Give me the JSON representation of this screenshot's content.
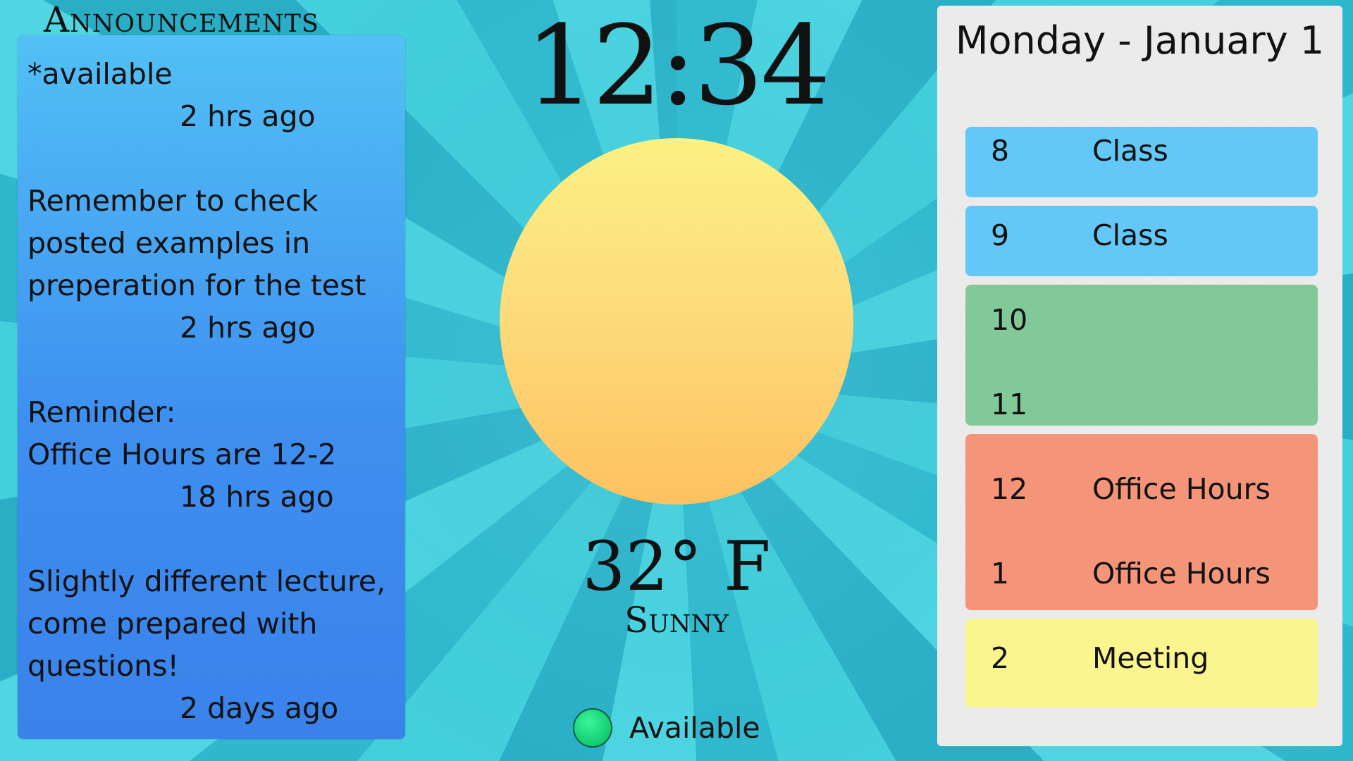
{
  "announcements": {
    "title": "Announcements",
    "items": [
      {
        "text": "*available",
        "time": "2 hrs ago"
      },
      {
        "text": "Remember to check\nposted examples in\npreperation for the test",
        "time": "2 hrs ago"
      },
      {
        "text": "Reminder:\nOffice Hours are 12-2",
        "time": "18 hrs ago"
      },
      {
        "text": "Slightly different lecture,\ncome prepared with\nquestions!",
        "time": "2 days ago"
      }
    ]
  },
  "clock": {
    "time": "12:34"
  },
  "weather": {
    "temperature": "32° F",
    "condition": "Sunny",
    "icon": "sun-icon"
  },
  "status": {
    "label": "Available",
    "color": "#17d177"
  },
  "schedule": {
    "date": "Monday - January 1",
    "slots": [
      {
        "hour": "8",
        "label": "Class"
      },
      {
        "hour": "9",
        "label": "Class"
      },
      {
        "hour": "10",
        "label": ""
      },
      {
        "hour": "11",
        "label": ""
      },
      {
        "hour": "12",
        "label": "Office Hours"
      },
      {
        "hour": "1",
        "label": "Office Hours"
      },
      {
        "hour": "2",
        "label": "Meeting"
      }
    ],
    "colors": {
      "class": "#63c8f7",
      "free": "#82c99a",
      "office_hours": "#f4957a",
      "meeting": "#fbf58f"
    }
  }
}
